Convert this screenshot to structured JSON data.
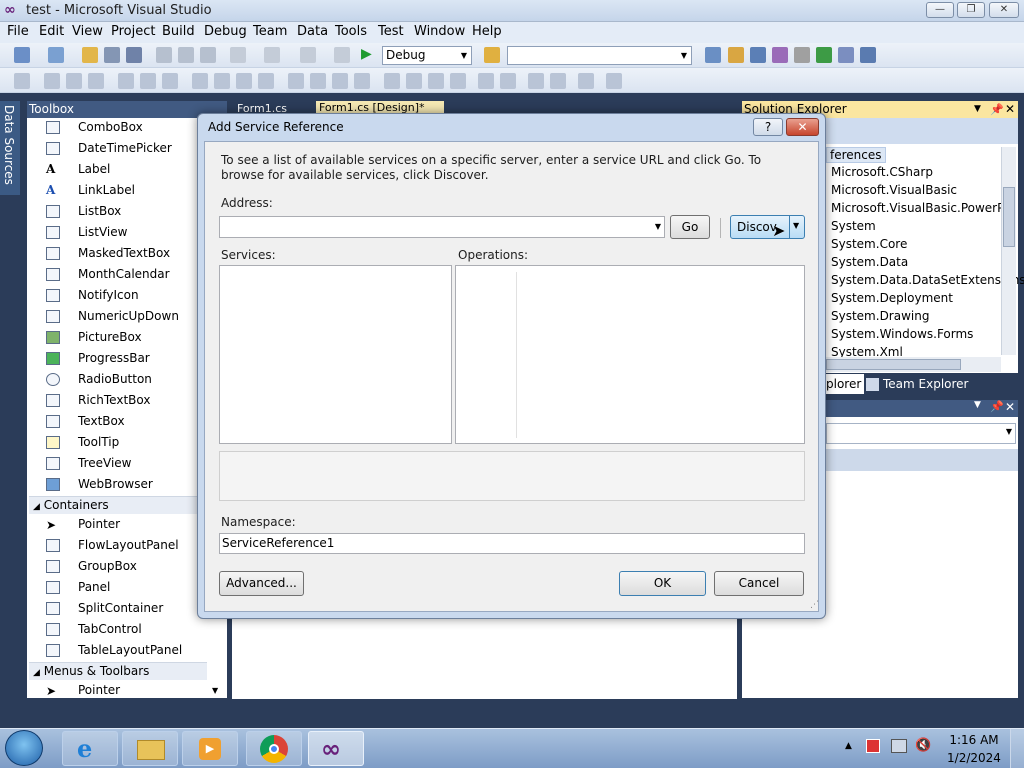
{
  "window": {
    "title": "test - Microsoft Visual Studio",
    "controls": {
      "minimize": "—",
      "restore": "❐",
      "close": "✕"
    }
  },
  "menu": [
    "File",
    "Edit",
    "View",
    "Project",
    "Build",
    "Debug",
    "Team",
    "Data",
    "Tools",
    "Test",
    "Window",
    "Help"
  ],
  "toolbar": {
    "config_value": "Debug",
    "platform_value": ""
  },
  "side_tabs": {
    "data_sources": "Data Sources"
  },
  "toolbox": {
    "title": "Toolbox",
    "common_items": [
      "ComboBox",
      "DateTimePicker",
      "Label",
      "LinkLabel",
      "ListBox",
      "ListView",
      "MaskedTextBox",
      "MonthCalendar",
      "NotifyIcon",
      "NumericUpDown",
      "PictureBox",
      "ProgressBar",
      "RadioButton",
      "RichTextBox",
      "TextBox",
      "ToolTip",
      "TreeView",
      "WebBrowser"
    ],
    "groups": [
      {
        "name": "Containers",
        "items": [
          "Pointer",
          "FlowLayoutPanel",
          "GroupBox",
          "Panel",
          "SplitContainer",
          "TabControl",
          "TableLayoutPanel"
        ]
      },
      {
        "name": "Menus & Toolbars",
        "items": [
          "Pointer"
        ]
      }
    ]
  },
  "editor_tabs": {
    "tab1": "Form1.cs",
    "tab2": "Form1.cs [Design]*"
  },
  "solution_explorer": {
    "title": "Solution Explorer",
    "references_label": "ferences",
    "items": [
      "Microsoft.CSharp",
      "Microsoft.VisualBasic",
      "Microsoft.VisualBasic.PowerPacl",
      "System",
      "System.Core",
      "System.Data",
      "System.Data.DataSetExtensions",
      "System.Deployment",
      "System.Drawing",
      "System.Windows.Forms",
      "System.Xml"
    ],
    "bottom_tabs": [
      "plorer",
      "Team Explorer"
    ]
  },
  "dialog": {
    "title": "Add Service Reference",
    "help": "?",
    "close": "✕",
    "instructions": "To see a list of available services on a specific server, enter a service URL and click Go. To browse for available services, click Discover.",
    "address_label": "Address:",
    "address_value": "",
    "go_label": "Go",
    "discover_label": "Discov",
    "services_label": "Services:",
    "operations_label": "Operations:",
    "namespace_label": "Namespace:",
    "namespace_value": "ServiceReference1",
    "advanced_label": "Advanced...",
    "ok_label": "OK",
    "cancel_label": "Cancel"
  },
  "taskbar": {
    "time": "1:16 AM",
    "date": "1/2/2024",
    "apps": [
      "start-orb",
      "internet-explorer",
      "file-explorer",
      "media-player",
      "chrome",
      "visual-studio"
    ]
  }
}
